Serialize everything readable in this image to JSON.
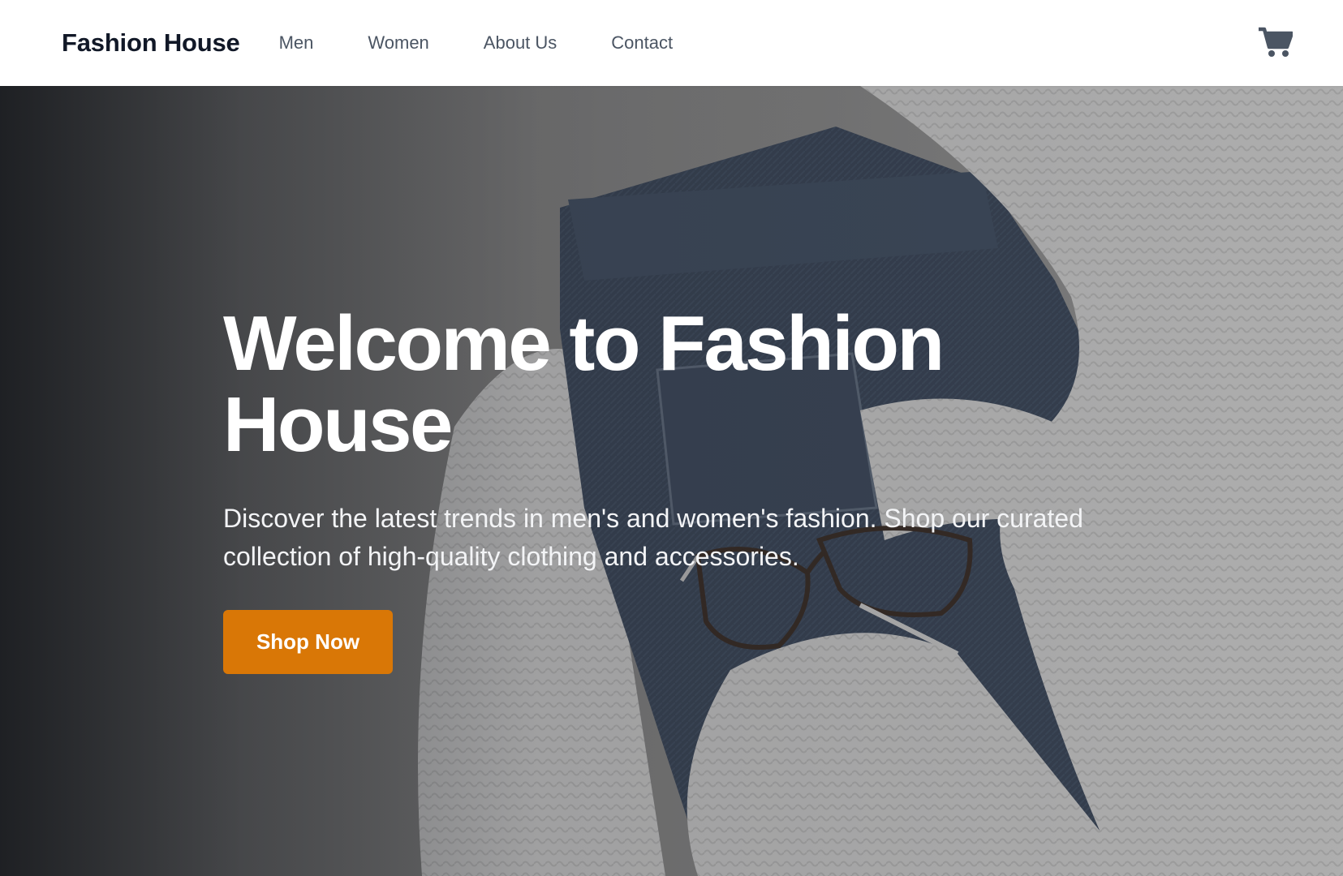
{
  "nav": {
    "brand": "Fashion House",
    "links": [
      "Men",
      "Women",
      "About Us",
      "Contact"
    ],
    "cart_icon": "shopping-cart-icon"
  },
  "hero": {
    "title": "Welcome to Fashion House",
    "subtitle": "Discover the latest trends in men's and women's fashion. Shop our curated collection of high-quality clothing and accessories.",
    "cta_label": "Shop Now",
    "background_image": "flat-lay of folded dark denim jeans, white knit sweaters and eyeglasses"
  },
  "colors": {
    "accent": "#d97706",
    "brand_text": "#111827",
    "nav_text": "#4b5563",
    "hero_text": "#ffffff"
  }
}
